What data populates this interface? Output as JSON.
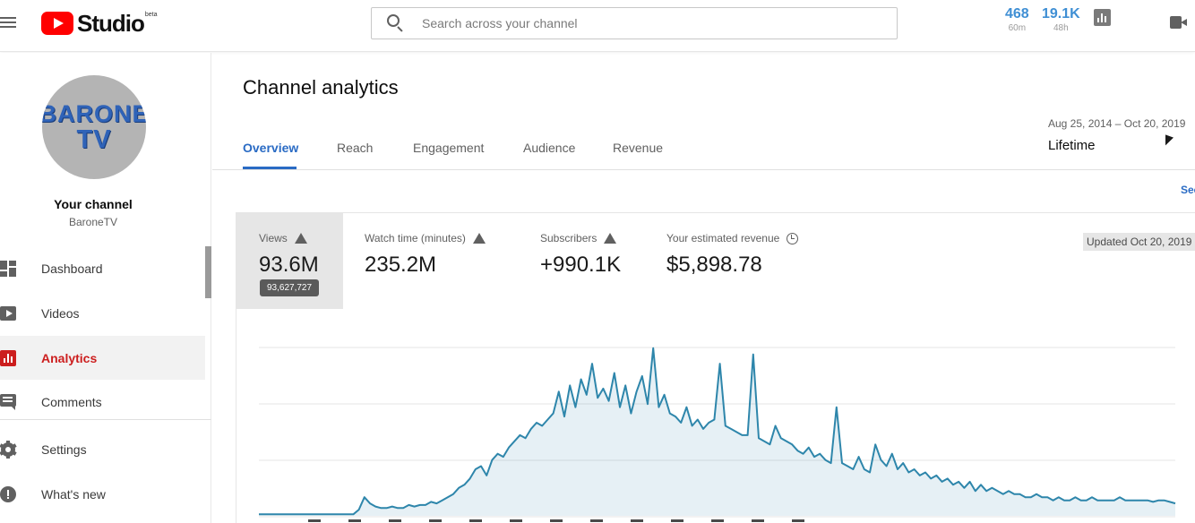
{
  "header": {
    "logo_text": "Studio",
    "logo_beta": "beta",
    "search_placeholder": "Search across your channel",
    "realtime": [
      {
        "value": "468",
        "label": "60m"
      },
      {
        "value": "19.1K",
        "label": "48h"
      }
    ]
  },
  "sidebar": {
    "avatar_text_1": "BARONE",
    "avatar_text_2": "TV",
    "channel_title": "Your channel",
    "channel_handle": "BaroneTV",
    "items": [
      {
        "label": "Dashboard",
        "icon": "dashboard-icon"
      },
      {
        "label": "Videos",
        "icon": "videos-icon"
      },
      {
        "label": "Analytics",
        "icon": "analytics-icon",
        "active": true
      },
      {
        "label": "Comments",
        "icon": "comments-icon"
      },
      {
        "label": "Settings",
        "icon": "settings-icon"
      },
      {
        "label": "What's new",
        "icon": "whats-new-icon"
      }
    ]
  },
  "main": {
    "title": "Channel analytics",
    "tabs": [
      "Overview",
      "Reach",
      "Engagement",
      "Audience",
      "Revenue"
    ],
    "active_tab": "Overview",
    "date_range": "Aug 25, 2014 – Oct 20, 2019",
    "date_preset": "Lifetime",
    "see_more": "See",
    "updated": "Updated Oct 20, 2019",
    "metrics": [
      {
        "label": "Views",
        "value": "93.6M",
        "tooltip": "93,627,727",
        "icon": "warning-icon"
      },
      {
        "label": "Watch time (minutes)",
        "value": "235.2M",
        "icon": "warning-icon"
      },
      {
        "label": "Subscribers",
        "value": "+990.1K",
        "icon": "warning-icon"
      },
      {
        "label": "Your estimated revenue",
        "value": "$5,898.78",
        "icon": "clock-icon"
      }
    ]
  },
  "colors": {
    "accent": "#2a6bc4",
    "active_red": "#cc1e1e",
    "line": "#2e86ab",
    "realtime": "#3f8fd4"
  },
  "chart_data": {
    "type": "line",
    "series": [
      {
        "values": [
          1,
          1,
          1,
          1,
          1,
          1,
          1,
          1,
          1,
          1,
          1,
          1,
          1,
          1,
          1,
          1,
          1,
          1,
          4,
          12,
          8,
          6,
          5,
          5,
          6,
          5,
          5,
          7,
          6,
          7,
          7,
          9,
          8,
          10,
          12,
          14,
          18,
          20,
          24,
          30,
          32,
          26,
          36,
          40,
          38,
          44,
          48,
          52,
          50,
          56,
          60,
          58,
          62,
          66,
          80,
          64,
          84,
          70,
          88,
          78,
          98,
          76,
          82,
          74,
          92,
          70,
          84,
          66,
          80,
          90,
          72,
          108,
          70,
          78,
          66,
          64,
          60,
          70,
          58,
          62,
          56,
          60,
          62,
          98,
          58,
          56,
          54,
          52,
          52,
          104,
          50,
          48,
          46,
          58,
          50,
          48,
          46,
          42,
          40,
          44,
          38,
          40,
          36,
          34,
          70,
          34,
          32,
          30,
          38,
          30,
          28,
          46,
          36,
          32,
          40,
          30,
          34,
          28,
          30,
          26,
          28,
          24,
          26,
          22,
          24,
          20,
          22,
          18,
          22,
          16,
          20,
          16,
          18,
          16,
          14,
          16,
          14,
          14,
          12,
          12,
          14,
          12,
          12,
          10,
          12,
          10,
          10,
          12,
          10,
          10,
          12,
          10,
          10,
          10,
          10,
          12,
          10,
          10,
          10,
          10,
          10,
          9,
          10,
          10,
          9,
          8
        ],
        "ylim": [
          0,
          120
        ]
      }
    ],
    "xlabel": "",
    "ylabel": "",
    "grid": true
  }
}
